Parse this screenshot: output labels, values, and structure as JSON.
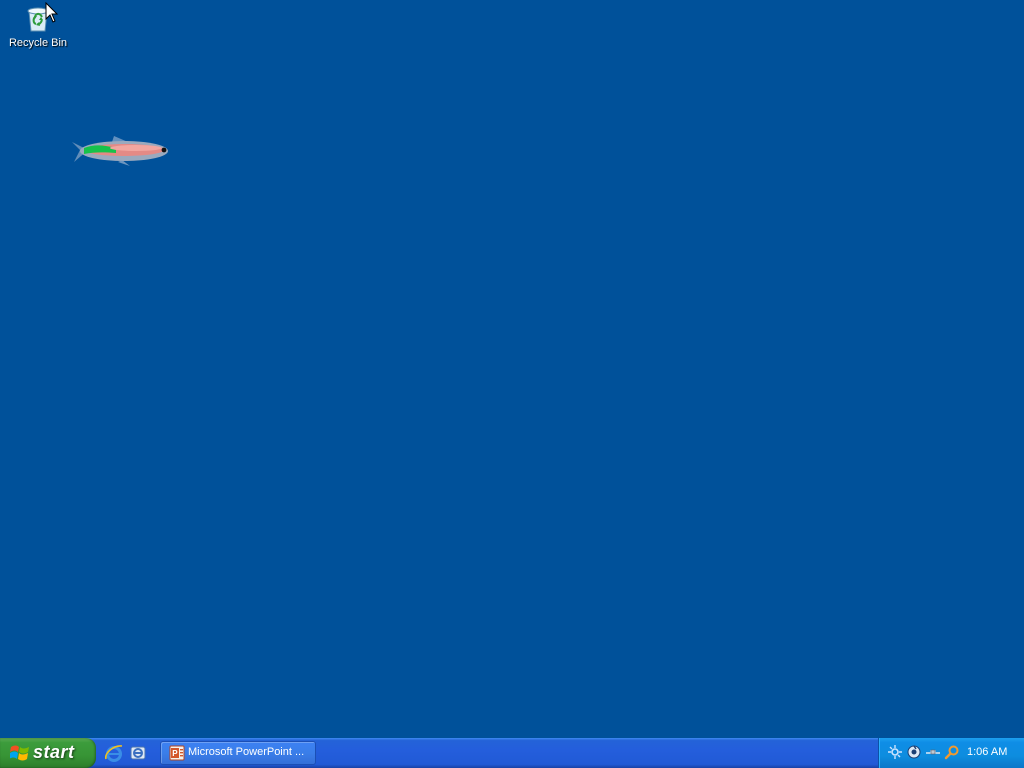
{
  "desktop": {
    "background_color": "#00519a",
    "icons": [
      {
        "label": "Recycle Bin",
        "icon": "recycle-bin-icon"
      }
    ],
    "wallpaper_decoration": "fish-icon"
  },
  "taskbar": {
    "start": {
      "label": "start",
      "icon": "windows-flag-icon"
    },
    "quick_launch": [
      {
        "icon": "internet-explorer-icon"
      },
      {
        "icon": "show-desktop-icon"
      }
    ],
    "tasks": [
      {
        "label": "Microsoft PowerPoint ...",
        "icon": "powerpoint-icon"
      }
    ],
    "tray": {
      "icons": [
        "network-icon",
        "volume-icon",
        "connection-icon",
        "search-icon"
      ],
      "clock": "1:06 AM"
    }
  }
}
